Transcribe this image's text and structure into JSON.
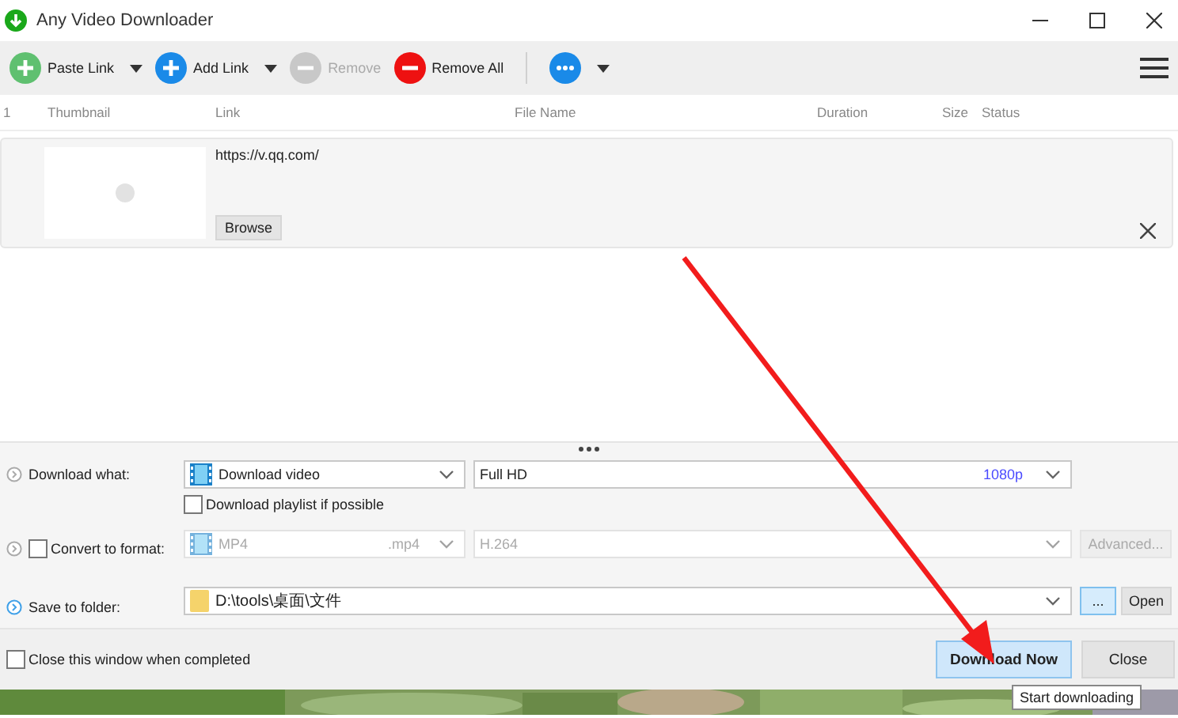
{
  "window": {
    "title": "Any Video Downloader"
  },
  "toolbar": {
    "buttons": [
      {
        "label": "Paste Link",
        "kind": "paste",
        "disabled": false,
        "menu": true
      },
      {
        "label": "Add Link",
        "kind": "add",
        "disabled": false,
        "menu": true
      },
      {
        "label": "Remove",
        "kind": "remove",
        "disabled": true,
        "menu": false
      },
      {
        "label": "Remove All",
        "kind": "remove_all",
        "disabled": false,
        "menu": false
      },
      {
        "kind": "more",
        "disabled": false,
        "menu": true
      }
    ]
  },
  "table": {
    "columns": [
      "1",
      "Thumbnail",
      "Link",
      "File Name",
      "Duration",
      "Size",
      "Status"
    ],
    "rows": [
      {
        "link": "https://v.qq.com/",
        "browse": "Browse"
      }
    ]
  },
  "options": {
    "download_what": {
      "label": "Download what:",
      "type": "Download video",
      "quality": "Full HD",
      "resolution": "1080p",
      "playlist": {
        "label": "Download playlist if possible",
        "checked": false
      }
    },
    "convert": {
      "label": "Convert to format:",
      "checked": false,
      "format": "MP4",
      "extension": ".mp4",
      "codec": "H.264",
      "advanced": "Advanced..."
    },
    "save": {
      "label": "Save to folder:",
      "path": "D:\\tools\\桌面\\文件",
      "browse": "...",
      "open": "Open"
    }
  },
  "footer": {
    "close_when_done": {
      "label": "Close this window when completed",
      "checked": false
    },
    "buttons": [
      {
        "label": "Download Now",
        "primary": true
      },
      {
        "label": "Close",
        "primary": false
      }
    ],
    "tooltip": "Start downloading"
  }
}
